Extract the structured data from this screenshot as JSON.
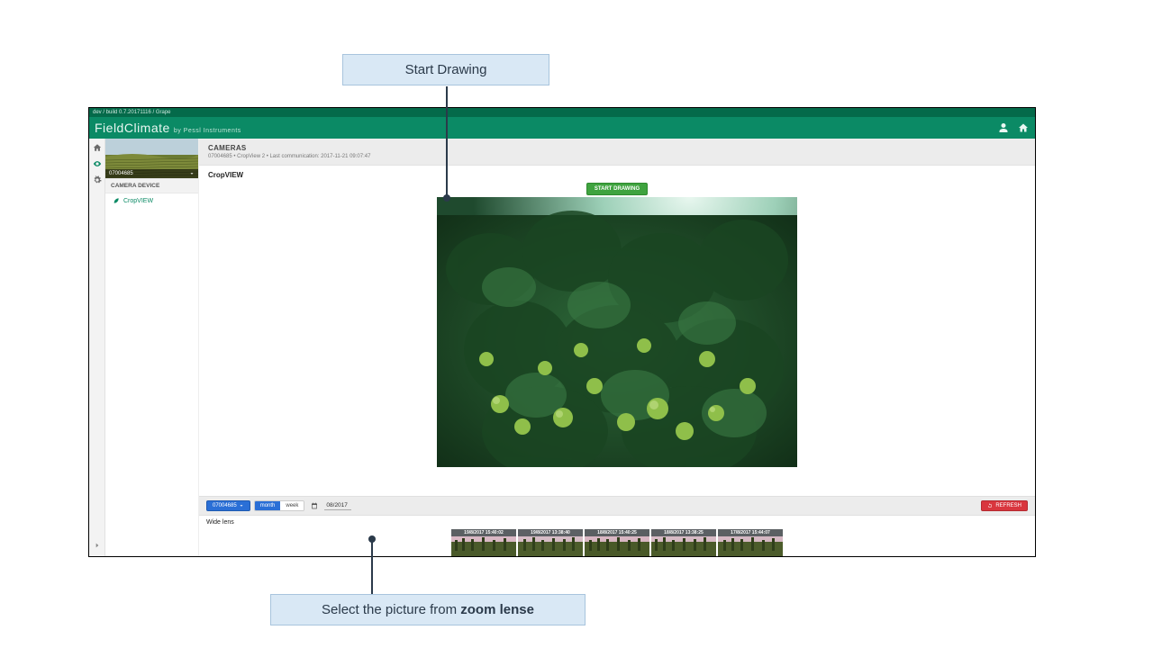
{
  "annotations": {
    "top": "Start Drawing",
    "bottom_prefix": "Select the picture from ",
    "bottom_bold": "zoom lense"
  },
  "build_label": "dev / build 0.7.20171116 / Grape",
  "brand": {
    "name": "FieldClimate",
    "byline": "by Pessl Instruments"
  },
  "station": {
    "id": "07004685",
    "section": "CAMERA DEVICE",
    "item": "CropVIEW"
  },
  "cameras": {
    "title": "CAMERAS",
    "subtitle": "07004685 • CropView 2 • Last communication: 2017-11-21 09:07:47"
  },
  "card": {
    "title": "CropVIEW"
  },
  "buttons": {
    "start_drawing": "START DRAWING",
    "refresh": "REFRESH"
  },
  "toolbar": {
    "station_btn": "07004685",
    "seg_month": "month",
    "seg_week": "week",
    "date": "08/2017"
  },
  "lens": {
    "label": "Wide lens",
    "thumbs": [
      "19/8/2017 15:40:02",
      "19/8/2017 13:38:40",
      "18/8/2017 15:40:25",
      "18/8/2017 13:38:25",
      "17/8/2017 15:44:07"
    ]
  }
}
